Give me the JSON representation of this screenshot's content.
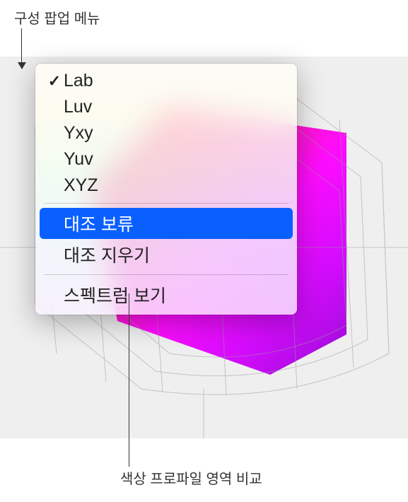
{
  "annotations": {
    "top": "구성 팝업 메뉴",
    "bottom": "색상 프로파일 영역 비교"
  },
  "menu": {
    "items": [
      {
        "label": "Lab",
        "checked": true
      },
      {
        "label": "Luv",
        "checked": false
      },
      {
        "label": "Yxy",
        "checked": false
      },
      {
        "label": "Yuv",
        "checked": false
      },
      {
        "label": "XYZ",
        "checked": false
      }
    ],
    "actions": [
      {
        "label": "대조 보류",
        "highlighted": true
      },
      {
        "label": "대조 지우기",
        "highlighted": false
      }
    ],
    "footer": [
      {
        "label": "스펙트럼 보기"
      }
    ],
    "checkmark": "✓"
  }
}
